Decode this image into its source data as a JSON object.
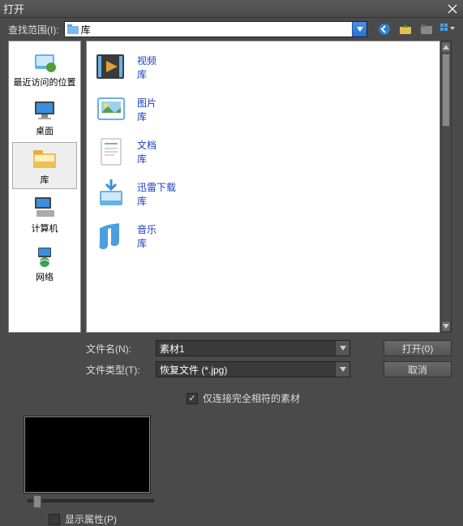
{
  "title": "打开",
  "lookin_label": "查找范围(I):",
  "lookin_value": "库",
  "sidebar": [
    {
      "label": "最近访问的位置",
      "icon": "recent"
    },
    {
      "label": "桌面",
      "icon": "desktop"
    },
    {
      "label": "库",
      "icon": "libraries",
      "selected": true
    },
    {
      "label": "计算机",
      "icon": "computer"
    },
    {
      "label": "网络",
      "icon": "network"
    }
  ],
  "items": [
    {
      "name": "视频",
      "type": "库",
      "icon": "video"
    },
    {
      "name": "图片",
      "type": "库",
      "icon": "pictures"
    },
    {
      "name": "文档",
      "type": "库",
      "icon": "documents"
    },
    {
      "name": "迅雷下载",
      "type": "库",
      "icon": "download"
    },
    {
      "name": "音乐",
      "type": "库",
      "icon": "music"
    }
  ],
  "filename_label": "文件名(N):",
  "filename_value": "素材1",
  "filetype_label": "文件类型(T):",
  "filetype_value": "恢复文件 (*.jpg)",
  "open_btn": "打开(0)",
  "cancel_btn": "取消",
  "link_matching": "仅连接完全相符的素材",
  "show_props": "显示属性(P)"
}
